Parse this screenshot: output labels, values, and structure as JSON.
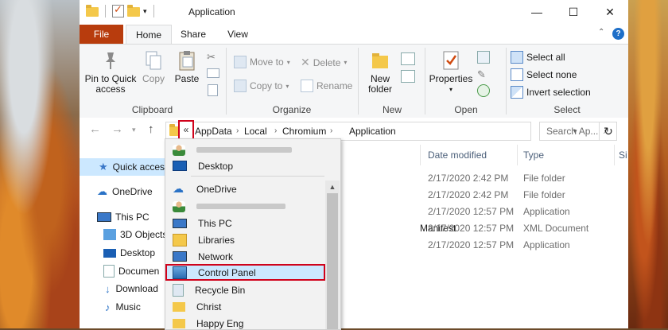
{
  "window": {
    "title": "Application"
  },
  "ribbon_tabs": [
    "File",
    "Home",
    "Share",
    "View"
  ],
  "ribbon": {
    "clipboard": {
      "pin": "Pin to Quick access",
      "copy": "Copy",
      "paste": "Paste",
      "label": "Clipboard"
    },
    "organize": {
      "move_to": "Move to",
      "copy_to": "Copy to",
      "delete": "Delete",
      "rename": "Rename",
      "label": "Organize"
    },
    "new": {
      "new_folder": "New folder",
      "label": "New"
    },
    "open": {
      "properties": "Properties",
      "label": "Open"
    },
    "select": {
      "select_all": "Select all",
      "select_none": "Select none",
      "invert": "Invert selection",
      "label": "Select"
    }
  },
  "address": {
    "overflow": "«",
    "crumbs": [
      "AppData",
      "Local",
      "Chromium",
      "Application"
    ],
    "search_placeholder": "Search Ap..."
  },
  "nav_pane": [
    "Quick acces",
    "OneDrive",
    "This PC",
    "3D Objects",
    "Desktop",
    "Documen",
    "Download",
    "Music"
  ],
  "columns": [
    "Date modified",
    "Type",
    "Si"
  ],
  "rows": [
    {
      "name": "",
      "date": "2/17/2020 2:42 PM",
      "type": "File folder"
    },
    {
      "name": "",
      "date": "2/17/2020 2:42 PM",
      "type": "File folder"
    },
    {
      "name": "",
      "date": "2/17/2020 12:57 PM",
      "type": "Application"
    },
    {
      "name": "Manifest",
      "date": "2/17/2020 12:57 PM",
      "type": "XML Document"
    },
    {
      "name": "",
      "date": "2/17/2020 12:57 PM",
      "type": "Application"
    }
  ],
  "dropdown": [
    "Desktop",
    "OneDrive",
    "This PC",
    "Libraries",
    "Network",
    "Control Panel",
    "Recycle Bin",
    "Christ",
    "Happy Eng"
  ],
  "colors": {
    "file_tab": "#b83c0d",
    "highlight_border": "#d0021b",
    "selection": "#cce8ff"
  }
}
